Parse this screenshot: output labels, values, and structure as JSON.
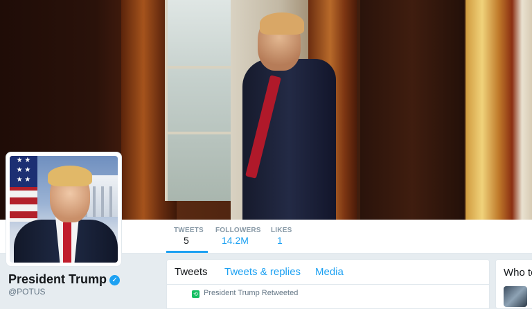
{
  "profile": {
    "name": "President Trump",
    "handle": "@POTUS",
    "verified_glyph": "✓"
  },
  "stats": [
    {
      "label": "TWEETS",
      "value": "5"
    },
    {
      "label": "FOLLOWERS",
      "value": "14.2M"
    },
    {
      "label": "LIKES",
      "value": "1"
    }
  ],
  "tabs": [
    {
      "label": "Tweets"
    },
    {
      "label": "Tweets & replies"
    },
    {
      "label": "Media"
    }
  ],
  "timeline": {
    "retweet_notice": "President Trump Retweeted"
  },
  "sidebar": {
    "who_to_follow_title": "Who to"
  },
  "colors": {
    "accent": "#1da1f2",
    "retweet": "#17bf63",
    "background": "#e6ecf0"
  }
}
